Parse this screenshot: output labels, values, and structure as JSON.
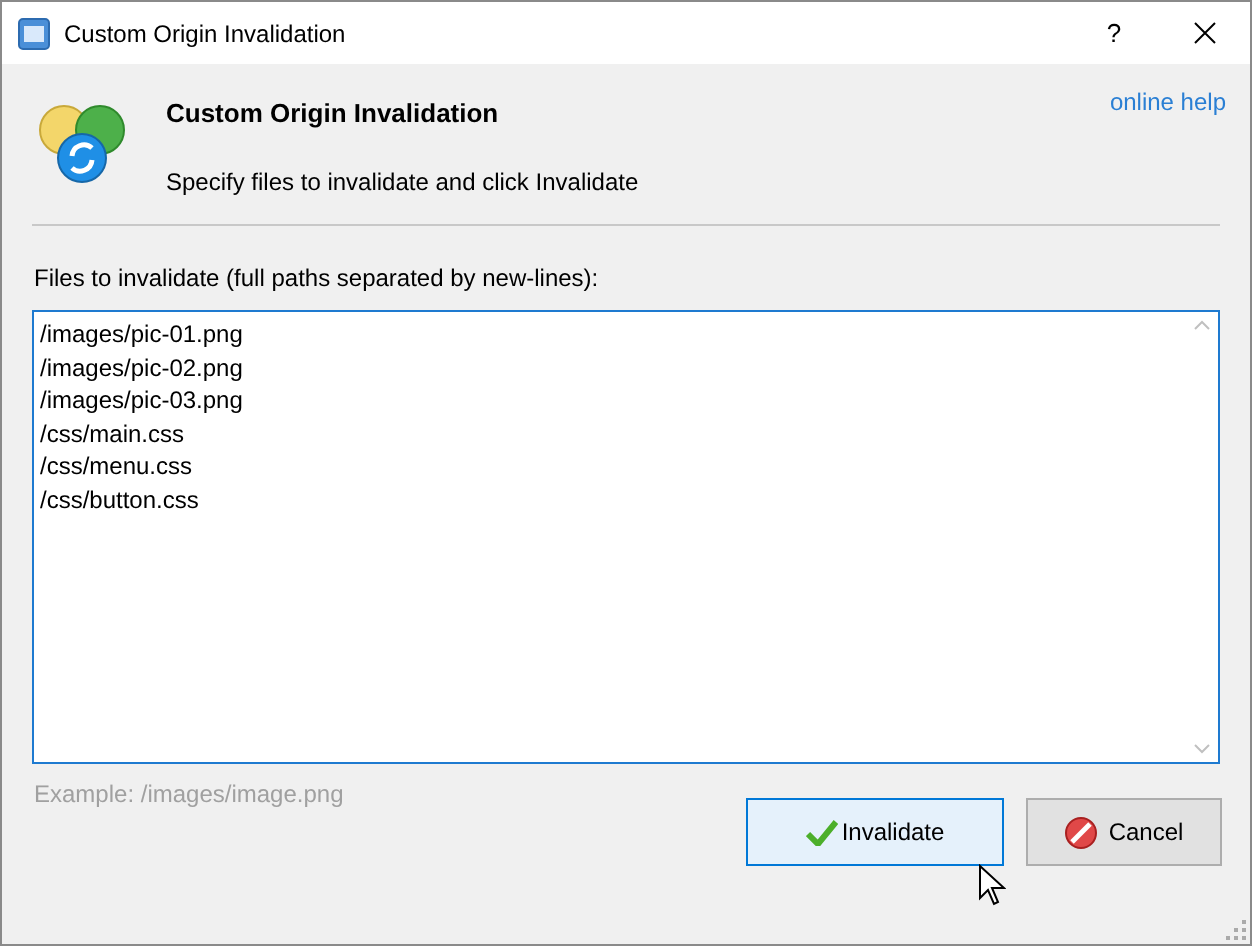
{
  "window": {
    "title": "Custom Origin Invalidation",
    "help_button": "?"
  },
  "header": {
    "title": "Custom Origin Invalidation",
    "subtitle": "Specify files to invalidate and click Invalidate",
    "link": "online help"
  },
  "files_field": {
    "label": "Files to invalidate (full paths separated by new-lines):",
    "lines": [
      "/images/pic-01.png",
      "/images/pic-02.png",
      "/images/pic-03.png",
      "/css/main.css",
      "/css/menu.css",
      "/css/button.css"
    ],
    "hint": "Example: /images/image.png"
  },
  "buttons": [
    {
      "kind": "ok",
      "label": "Invalidate",
      "hovered": true
    },
    {
      "kind": "cancel",
      "label": "Cancel",
      "hovered": false
    }
  ]
}
